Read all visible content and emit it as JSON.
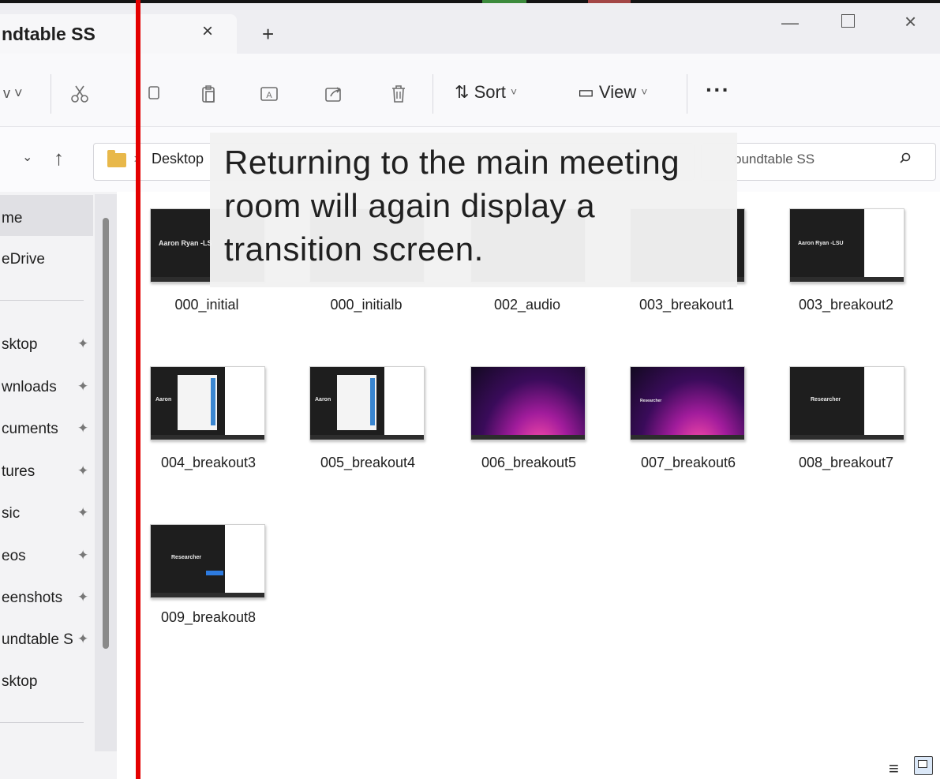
{
  "tab": {
    "title": "ndtable SS",
    "close": "×",
    "new": "+"
  },
  "window": {
    "minimize": "—",
    "close": "×"
  },
  "toolbar": {
    "new_chevron": "v ˅",
    "sort_label": "Sort",
    "view_label": "View",
    "more": "···",
    "sort_icon": "⇅",
    "view_icon": "▭"
  },
  "address": {
    "down": "⌄",
    "up": "↑",
    "separator": ">",
    "crumb": "Desktop",
    "search_placeholder": "oundtable SS"
  },
  "sidebar": {
    "items": [
      {
        "label": "me",
        "pinned": false
      },
      {
        "label": "eDrive",
        "pinned": false
      },
      {
        "label": "sktop",
        "pinned": true
      },
      {
        "label": "wnloads",
        "pinned": true
      },
      {
        "label": "cuments",
        "pinned": true
      },
      {
        "label": "tures",
        "pinned": true
      },
      {
        "label": "sic",
        "pinned": true
      },
      {
        "label": "eos",
        "pinned": true
      },
      {
        "label": "eenshots",
        "pinned": true
      },
      {
        "label": "undtable S",
        "pinned": true
      },
      {
        "label": "sktop",
        "pinned": false
      }
    ],
    "pin": "📌"
  },
  "files": [
    {
      "name": "000_initial",
      "thumb_text": "Aaron Ryan -LS"
    },
    {
      "name": "000_initialb",
      "thumb_text": ""
    },
    {
      "name": "002_audio",
      "thumb_text": ""
    },
    {
      "name": "003_breakout1",
      "thumb_text": ""
    },
    {
      "name": "003_breakout2",
      "thumb_text": "Aaron Ryan -LSU"
    },
    {
      "name": "004_breakout3",
      "thumb_text": "Aaron"
    },
    {
      "name": "005_breakout4",
      "thumb_text": "Aaron"
    },
    {
      "name": "006_breakout5",
      "thumb_text": ""
    },
    {
      "name": "007_breakout6",
      "thumb_text": "Researcher"
    },
    {
      "name": "008_breakout7",
      "thumb_text": "Researcher"
    },
    {
      "name": "009_breakout8",
      "thumb_text": "Researcher"
    }
  ],
  "overlay": {
    "text": "Returning to the main meeting room will again display a transition screen."
  },
  "status": {
    "details_icon": "≡"
  }
}
